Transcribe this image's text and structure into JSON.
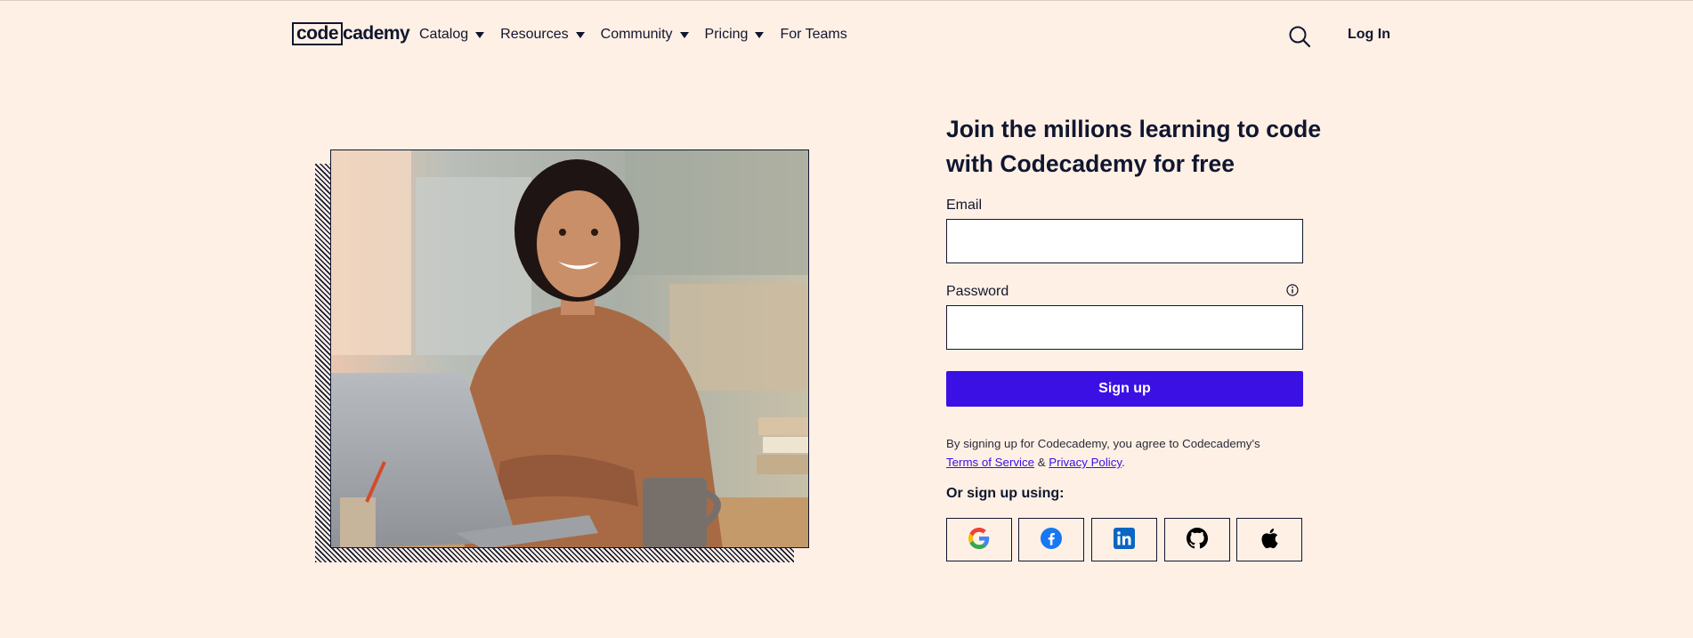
{
  "header": {
    "logo_box": "code",
    "logo_rest": "cademy",
    "nav": [
      {
        "label": "Catalog",
        "dropdown": true
      },
      {
        "label": "Resources",
        "dropdown": true
      },
      {
        "label": "Community",
        "dropdown": true
      },
      {
        "label": "Pricing",
        "dropdown": true
      },
      {
        "label": "For Teams",
        "dropdown": false
      }
    ],
    "search_icon": "search-icon",
    "login_label": "Log In"
  },
  "hero": {
    "image_description_icon": "photo-woman-laptop"
  },
  "form": {
    "headline": "Join the millions learning to code with Codecademy for free",
    "email_label": "Email",
    "email_value": "",
    "password_label": "Password",
    "password_value": "",
    "info_icon": "info-icon",
    "signup_label": "Sign up",
    "terms_prefix": "By signing up for Codecademy, you agree to Codecademy's",
    "terms_link": "Terms of Service",
    "terms_amp": " & ",
    "privacy_link": "Privacy Policy",
    "terms_period": ".",
    "or_label": "Or sign up using:",
    "social": [
      "google-icon",
      "facebook-icon",
      "linkedin-icon",
      "github-icon",
      "apple-icon"
    ]
  },
  "colors": {
    "background": "#FFF0E5",
    "navy": "#10162F",
    "primary": "#3A10E5"
  }
}
